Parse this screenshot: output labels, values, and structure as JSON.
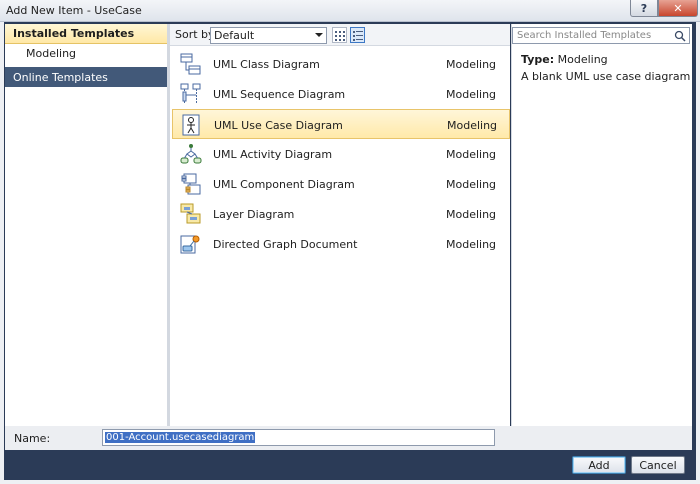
{
  "window": {
    "title": "Add New Item - UseCase",
    "help_glyph": "?",
    "close_glyph": "✕"
  },
  "left": {
    "installed_label": "Installed Templates",
    "modeling_label": "Modeling",
    "online_label": "Online Templates"
  },
  "toolbar": {
    "sort_label": "Sort by:",
    "sort_value": "Default"
  },
  "templates": [
    {
      "name": "UML Class Diagram",
      "category": "Modeling",
      "icon": "class-diagram-icon"
    },
    {
      "name": "UML Sequence Diagram",
      "category": "Modeling",
      "icon": "sequence-diagram-icon"
    },
    {
      "name": "UML Use Case Diagram",
      "category": "Modeling",
      "icon": "use-case-diagram-icon",
      "selected": true
    },
    {
      "name": "UML Activity Diagram",
      "category": "Modeling",
      "icon": "activity-diagram-icon"
    },
    {
      "name": "UML Component Diagram",
      "category": "Modeling",
      "icon": "component-diagram-icon"
    },
    {
      "name": "Layer Diagram",
      "category": "Modeling",
      "icon": "layer-diagram-icon"
    },
    {
      "name": "Directed Graph Document",
      "category": "Modeling",
      "icon": "directed-graph-icon"
    }
  ],
  "search": {
    "placeholder": "Search Installed Templates"
  },
  "details": {
    "type_label": "Type:",
    "type_value": "Modeling",
    "description": "A blank UML use case diagram"
  },
  "bottom": {
    "name_label": "Name:",
    "name_value": "001-Account.usecasediagram",
    "add_label": "Add",
    "cancel_label": "Cancel"
  }
}
